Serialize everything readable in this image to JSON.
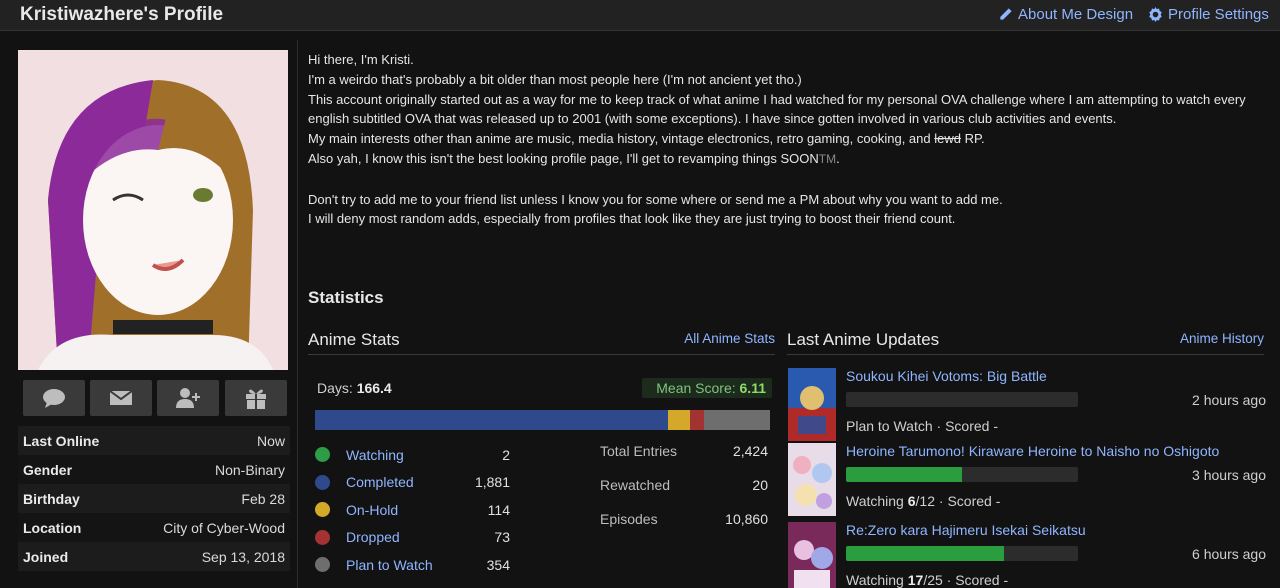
{
  "header": {
    "title": "Kristiwazhere's Profile",
    "about_design": "About Me Design",
    "profile_settings": "Profile Settings"
  },
  "sidebar": {
    "info": [
      {
        "label": "Last Online",
        "value": "Now"
      },
      {
        "label": "Gender",
        "value": "Non-Binary"
      },
      {
        "label": "Birthday",
        "value": "Feb 28"
      },
      {
        "label": "Location",
        "value": "City of Cyber-Wood"
      },
      {
        "label": "Joined",
        "value": "Sep 13, 2018"
      }
    ],
    "actions": [
      "comment-icon",
      "mail-icon",
      "add-friend-icon",
      "gift-icon"
    ]
  },
  "about": {
    "line1": "Hi there, I'm Kristi.",
    "line2": "I'm a weirdo that's probably a bit older than most people here (I'm not ancient yet tho.)",
    "line3": "This account originally started out as a way for me to keep track of what anime I had watched for my personal OVA challenge where I am attempting to watch every english subtitled OVA that was released up to 2001 (with some exceptions). I have since gotten involved in various club activities and events.",
    "line4_pre": "My main interests other than anime are music, media history, vintage electronics, retro gaming, cooking, and ",
    "line4_strike": "lewd",
    "line4_post": " RP.",
    "line5": "Also yah, I know this isn't the best looking profile page, I'll get to revamping things SOON",
    "line5_tm": "TM",
    "line5_end": ".",
    "line6": "Don't try to add me to your friend list unless I know you for some where or send me a PM about why you want to add me.",
    "line7": "I will deny most random adds, especially from profiles that look like they are just trying to boost their friend count."
  },
  "statistics": {
    "heading": "Statistics",
    "anime_stats": {
      "heading": "Anime Stats",
      "link": "All Anime Stats",
      "days_label": "Days: ",
      "days_value": "166.4",
      "mean_label": "Mean Score: ",
      "mean_value": "6.11",
      "statuses": [
        {
          "label": "Watching",
          "value": "2",
          "count": 2,
          "color": "#2e9c47"
        },
        {
          "label": "Completed",
          "value": "1,881",
          "count": 1881,
          "color": "#2e4a8c"
        },
        {
          "label": "On-Hold",
          "value": "114",
          "count": 114,
          "color": "#d4a92a"
        },
        {
          "label": "Dropped",
          "value": "73",
          "count": 73,
          "color": "#a33232"
        },
        {
          "label": "Plan to Watch",
          "value": "354",
          "count": 354,
          "color": "#6e6e6e"
        }
      ],
      "totals": [
        {
          "label": "Total Entries",
          "value": "2,424"
        },
        {
          "label": "Rewatched",
          "value": "20"
        },
        {
          "label": "Episodes",
          "value": "10,860"
        }
      ]
    },
    "updates": {
      "heading": "Last Anime Updates",
      "link": "Anime History",
      "items": [
        {
          "title": "Soukou Kihei Votoms: Big Battle",
          "status_pre": "Plan to Watch",
          "status_num": "",
          "status_total": "",
          "status_post": " · Scored -",
          "time": "2 hours ago",
          "progress": 0
        },
        {
          "title": "Heroine Tarumono! Kiraware Heroine to Naisho no Oshigoto",
          "status_pre": "Watching ",
          "status_num": "6",
          "status_total": "/12",
          "status_post": " · Scored -",
          "time": "3 hours ago",
          "progress": 0.5
        },
        {
          "title": "Re:Zero kara Hajimeru Isekai Seikatsu",
          "status_pre": "Watching ",
          "status_num": "17",
          "status_total": "/25",
          "status_post": " · Scored -",
          "time": "6 hours ago",
          "progress": 0.68
        }
      ]
    }
  }
}
